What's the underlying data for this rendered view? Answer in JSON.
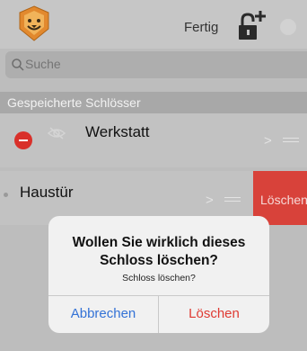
{
  "navbar": {
    "done_label": "Fertig",
    "icons": [
      "lion-logo-icon",
      "lock-add-icon",
      "circle-icon"
    ]
  },
  "search": {
    "placeholder": "Suche"
  },
  "section": {
    "title": "Gespeicherte Schlösser"
  },
  "rows": [
    {
      "title": "Werkstatt",
      "chevron": ">"
    },
    {
      "title": "Haustür",
      "chevron": ">",
      "swipe_action": "Löschen"
    }
  ],
  "dialog": {
    "title_line1": "Wollen Sie wirklich dieses",
    "title_line2": "Schloss löschen?",
    "message": "Schloss löschen?",
    "cancel_label": "Abbrechen",
    "delete_label": "Löschen"
  },
  "colors": {
    "delete_red": "#d8423a",
    "dialog_blue": "#3372d6",
    "logo_orange": "#e2892e"
  }
}
